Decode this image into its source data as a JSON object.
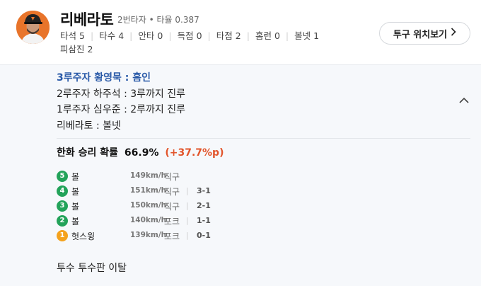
{
  "player": {
    "name": "리베라토",
    "order_role": "2번타자",
    "dot": "•",
    "avg_label": "타율",
    "avg": "0.387",
    "stats": [
      {
        "label": "타석",
        "value": "5"
      },
      {
        "label": "타수",
        "value": "4"
      },
      {
        "label": "안타",
        "value": "0"
      },
      {
        "label": "득점",
        "value": "0"
      },
      {
        "label": "타점",
        "value": "2"
      },
      {
        "label": "홈런",
        "value": "0"
      },
      {
        "label": "볼넷",
        "value": "1"
      },
      {
        "label": "피삼진",
        "value": "2"
      }
    ]
  },
  "pitch_view_button": {
    "label": "투구 위치보기",
    "icon": "chevron-right-icon"
  },
  "events": [
    {
      "text": "3루주자 황영묵 : 홈인",
      "highlight": true
    },
    {
      "text": "2루주자 하주석 : 3루까지 진루",
      "highlight": false
    },
    {
      "text": "1루주자 심우준 : 2루까지 진루",
      "highlight": false
    },
    {
      "text": "리베라토 : 볼넷",
      "highlight": false
    }
  ],
  "win_prob": {
    "label": "한화 승리 확률",
    "value": "66.9%",
    "delta": "(+37.7%p)"
  },
  "pitches": [
    {
      "num": "5",
      "result": "볼",
      "speed": "149km/h",
      "kind": "직구",
      "count": "",
      "color": "#23a35a"
    },
    {
      "num": "4",
      "result": "볼",
      "speed": "151km/h",
      "kind": "직구",
      "count": "3-1",
      "color": "#23a35a"
    },
    {
      "num": "3",
      "result": "볼",
      "speed": "150km/h",
      "kind": "직구",
      "count": "2-1",
      "color": "#23a35a"
    },
    {
      "num": "2",
      "result": "볼",
      "speed": "140km/h",
      "kind": "포크",
      "count": "1-1",
      "color": "#23a35a"
    },
    {
      "num": "1",
      "result": "헛스윙",
      "speed": "139km/h",
      "kind": "포크",
      "count": "0-1",
      "color": "#f4a21d"
    }
  ],
  "count_separator": "|",
  "result_text": "투수 투수판 이탈"
}
